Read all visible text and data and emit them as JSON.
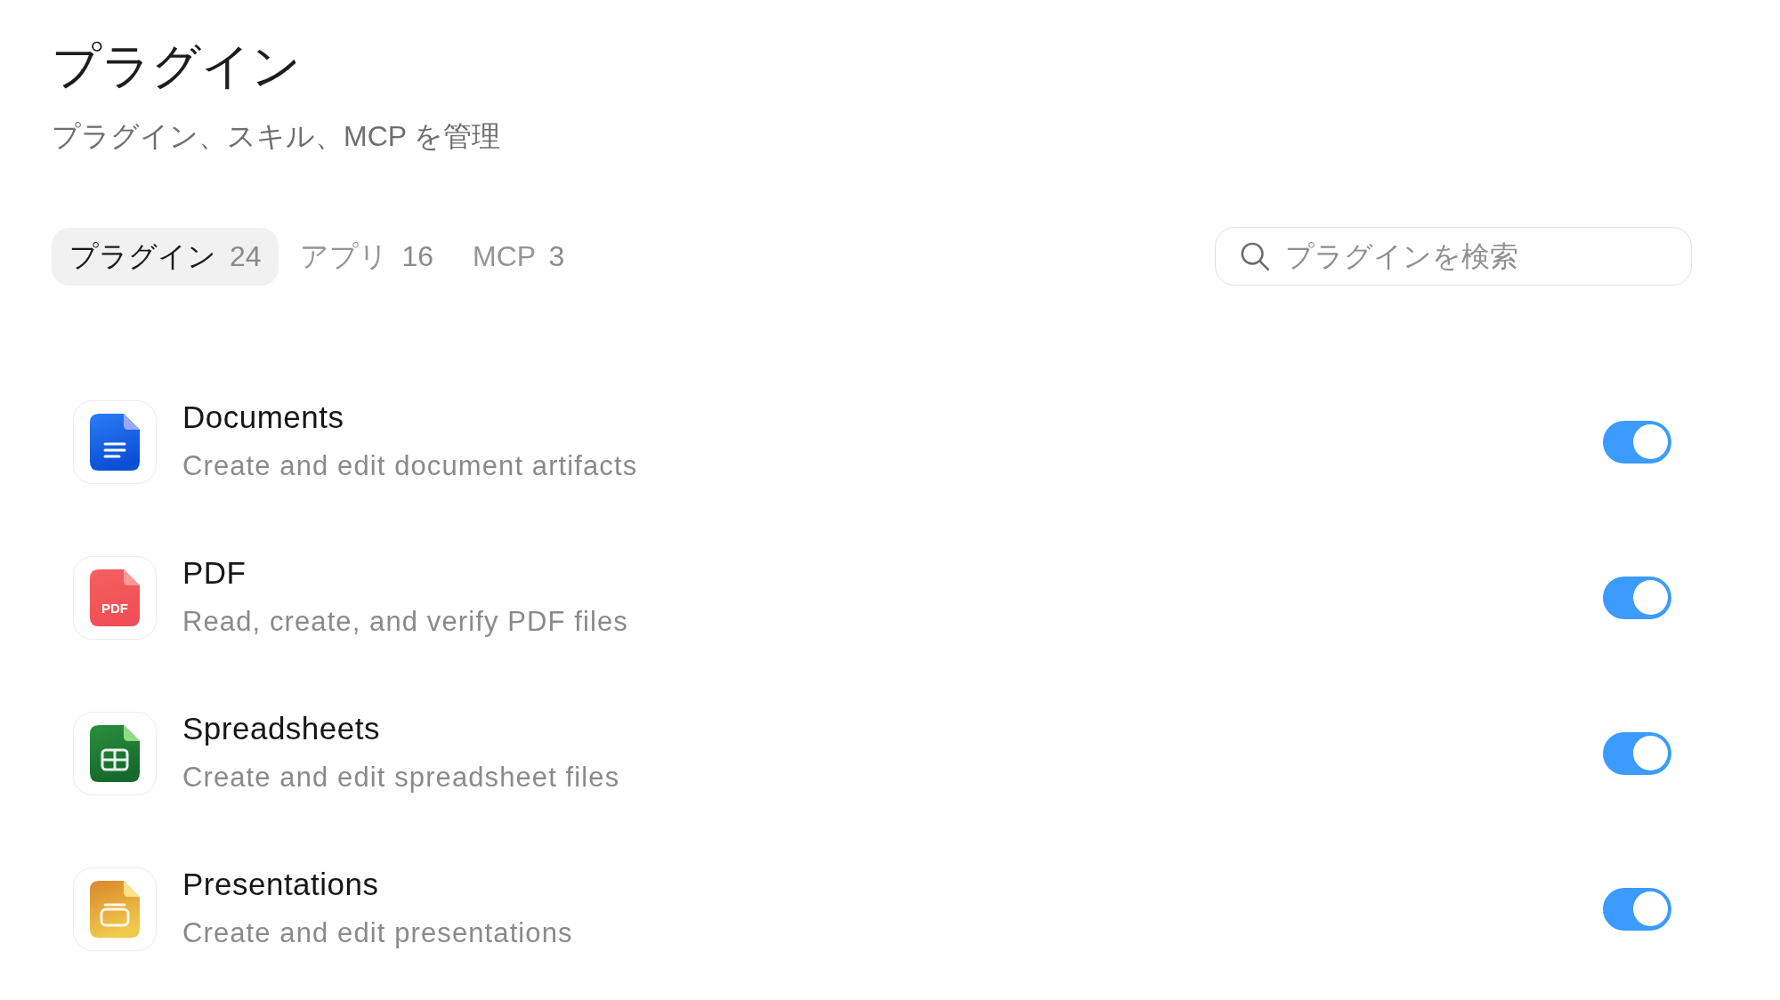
{
  "header": {
    "title": "プラグイン",
    "subtitle": "プラグイン、スキル、MCP を管理"
  },
  "tabs": [
    {
      "label": "プラグイン",
      "count": "24",
      "selected": true
    },
    {
      "label": "アプリ",
      "count": "16",
      "selected": false
    },
    {
      "label": "MCP",
      "count": "3",
      "selected": false
    }
  ],
  "search": {
    "placeholder": "プラグインを検索"
  },
  "plugins": [
    {
      "kind": "document",
      "name": "Documents",
      "description": "Create and edit document artifacts",
      "on": true
    },
    {
      "kind": "pdf",
      "icon_text": "PDF",
      "name": "PDF",
      "description": "Read, create, and verify PDF files",
      "on": true
    },
    {
      "kind": "spreadsheet",
      "name": "Spreadsheets",
      "description": "Create and edit spreadsheet files",
      "on": true
    },
    {
      "kind": "presentation",
      "name": "Presentations",
      "description": "Create and edit presentations",
      "on": true
    }
  ]
}
